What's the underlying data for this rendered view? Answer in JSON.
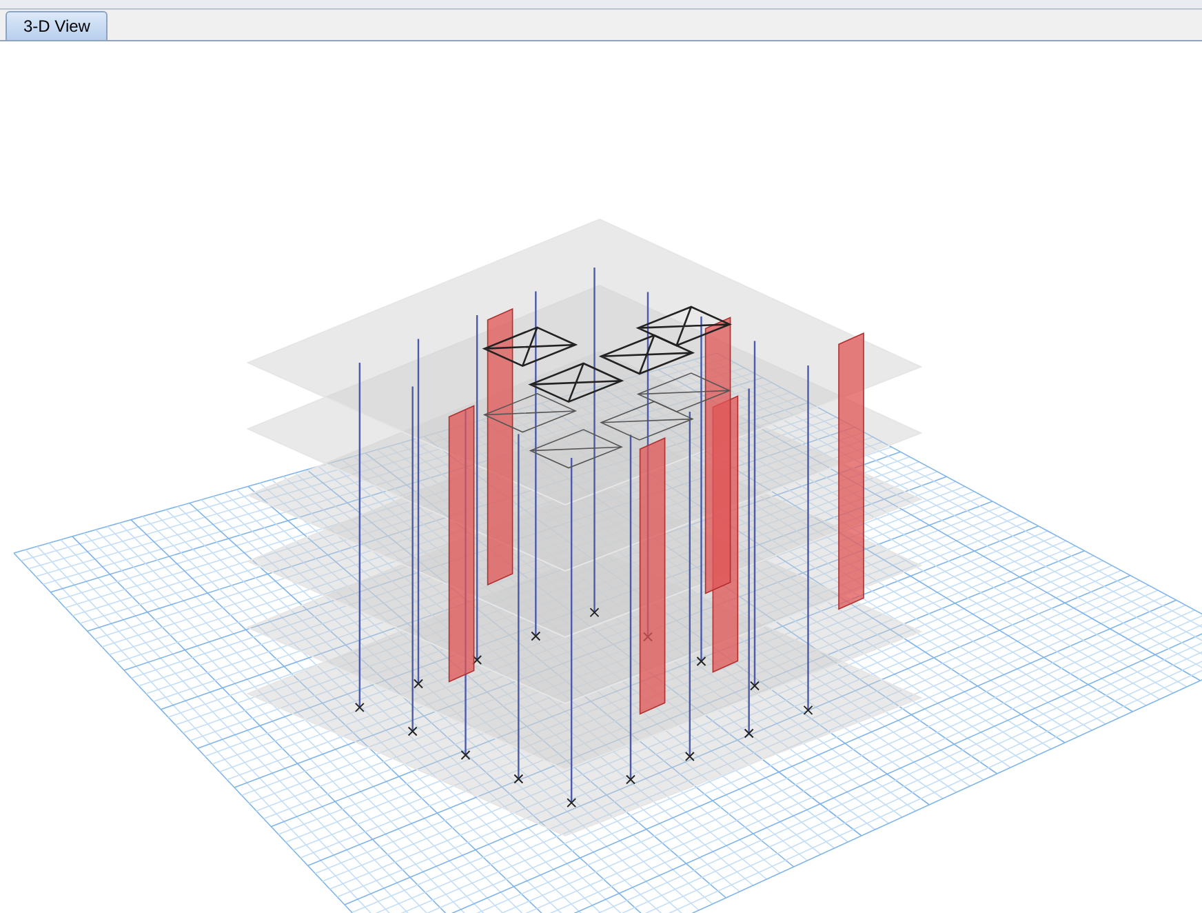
{
  "tabs": [
    {
      "label": "3-D View",
      "selected": true
    }
  ]
}
